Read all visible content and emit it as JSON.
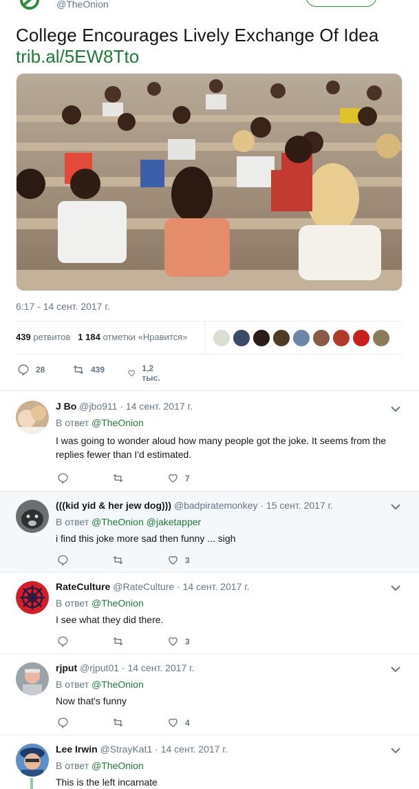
{
  "header": {
    "handle": "@TheOnion"
  },
  "tweet": {
    "text": "College Encourages Lively Exchange Of Idea",
    "link": "trib.al/5EW8Tto",
    "timestamp": "6:17 - 14 сент. 2017 г.",
    "retweets_count": "439",
    "retweets_label": "ретвитов",
    "likes_count": "1 184",
    "likes_label": "отметки «Нравится»",
    "replies": "28",
    "retweets": "439",
    "likes": "1,2 тыс."
  },
  "liker_avatar_colors": [
    "#d9dfd3",
    "#3b4a66",
    "#2a1c18",
    "#4e3b24",
    "#6d86a8",
    "#8a5a48",
    "#b23a2a",
    "#c8201c",
    "#8c7a5a"
  ],
  "replies": [
    {
      "name": "J Bo",
      "handle": "@jbo911",
      "date": "· 14 сент. 2017 г.",
      "reply_prefix": "В ответ",
      "mentions": "@TheOnion",
      "text": "I was going to wonder aloud how many people got the joke.  It seems from the replies fewer than I'd estimated.",
      "reply_count": "",
      "retweet_count": "",
      "like_count": "7"
    },
    {
      "name": "(((kid yid & her jew dog)))",
      "handle": "@badpiratemonkey",
      "date": "· 15 сент. 2017 г.",
      "reply_prefix": "В ответ",
      "mentions": "@TheOnion @jaketapper",
      "text": "i find this joke more sad then funny ... sigh",
      "reply_count": "",
      "retweet_count": "",
      "like_count": "3"
    },
    {
      "name": "RateCulture",
      "handle": "@RateCulture",
      "date": "· 14 сент. 2017 г.",
      "reply_prefix": "В ответ",
      "mentions": "@TheOnion",
      "text": "I see what they did there.",
      "reply_count": "",
      "retweet_count": "",
      "like_count": "3"
    },
    {
      "name": "rjput",
      "handle": "@rjput01",
      "date": "· 14 сент. 2017 г.",
      "reply_prefix": "В ответ",
      "mentions": "@TheOnion",
      "text": "Now that's funny",
      "reply_count": "",
      "retweet_count": "",
      "like_count": "4"
    },
    {
      "name": "Lee Irwin",
      "handle": "@StrayKat1",
      "date": "· 14 сент. 2017 г.",
      "reply_prefix": "В ответ",
      "mentions": "@TheOnion",
      "text": "This is the left incarnate"
    }
  ],
  "colors": {
    "accent": "#1f7a3a",
    "text": "#14171a",
    "muted": "#657786",
    "highlight_row": "#f5f8fa"
  }
}
